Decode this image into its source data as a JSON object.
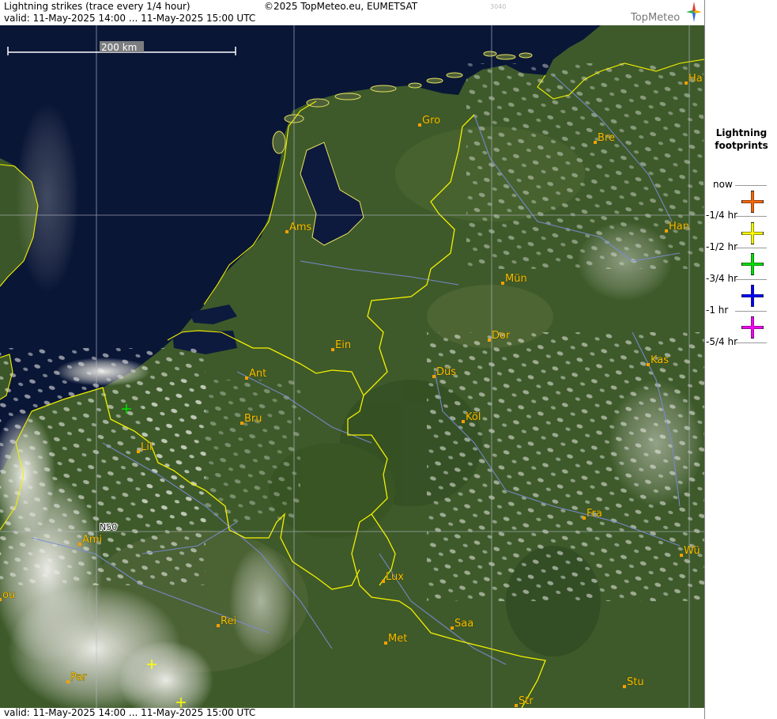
{
  "header": {
    "title": "Lightning strikes (trace every 1/4 hour)",
    "copyright": "©2025 TopMeteo.eu, EUMETSAT",
    "code": "3040",
    "valid": "valid:  11-May-2025 14:00 ... 11-May-2025 15:00 UTC",
    "logo": "TopMeteo"
  },
  "footer": {
    "valid": "valid:  11-May-2025 14:00 ... 11-May-2025 15:00 UTC"
  },
  "map": {
    "scale_label": "200 km",
    "lat_label": "N50",
    "cities": [
      {
        "label": "Gro"
      },
      {
        "label": "Bre"
      },
      {
        "label": "Ha"
      },
      {
        "label": "Ams"
      },
      {
        "label": "Han"
      },
      {
        "label": "Mün"
      },
      {
        "label": "Dor"
      },
      {
        "label": "Ein"
      },
      {
        "label": "Ant"
      },
      {
        "label": "Düs"
      },
      {
        "label": "Kas"
      },
      {
        "label": "Bru"
      },
      {
        "label": "Köl"
      },
      {
        "label": "Lil"
      },
      {
        "label": "Fra"
      },
      {
        "label": "Ami"
      },
      {
        "label": "Wü"
      },
      {
        "label": "Lux"
      },
      {
        "label": "ou"
      },
      {
        "label": "Rei"
      },
      {
        "label": "Saa"
      },
      {
        "label": "Met"
      },
      {
        "label": "Par"
      },
      {
        "label": "Stu"
      },
      {
        "label": "Str"
      }
    ],
    "strikes": [
      {
        "period": "-3/4 hr",
        "color": "#00e000"
      },
      {
        "period": "-1/4 hr",
        "color": "#ffff00"
      },
      {
        "period": "-1/4 hr",
        "color": "#ffff00"
      }
    ]
  },
  "legend": {
    "title_line1": "Lightning",
    "title_line2": "footprints",
    "labels": [
      "now",
      "-1/4 hr",
      "-1/2 hr",
      "-3/4 hr",
      "-1 hr",
      "-5/4 hr"
    ],
    "colors": [
      "#ff6600",
      "#ffff00",
      "#00e000",
      "#0000ff",
      "#ff00ff"
    ]
  }
}
